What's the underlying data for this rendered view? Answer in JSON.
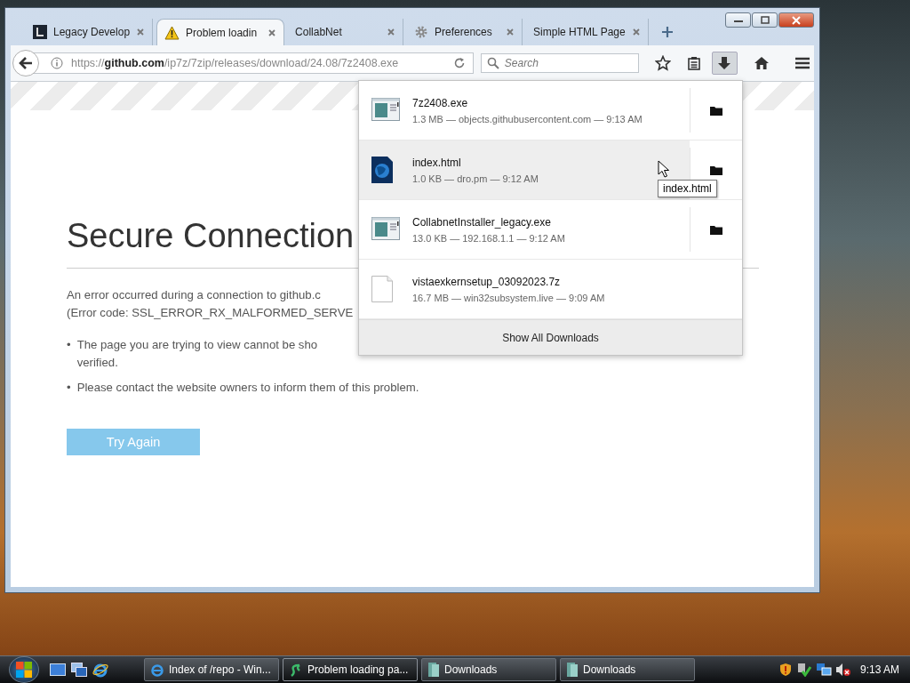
{
  "window": {
    "tabs": [
      {
        "label": "Legacy Develop",
        "selected": false
      },
      {
        "label": "Problem loadin",
        "selected": true
      },
      {
        "label": "CollabNet",
        "selected": false
      },
      {
        "label": "Preferences",
        "selected": false
      },
      {
        "label": "Simple HTML Page",
        "selected": false
      }
    ],
    "address_bar": {
      "url": "https://**github.com**/ip7z/7zip/releases/download/24.08/7z2408.exe"
    },
    "search": {
      "placeholder": "Search"
    },
    "downloads_button": {
      "pressed": true
    },
    "page": {
      "title": "Secure Connection",
      "message_lines": [
        "An error occurred during a connection to github.c",
        "(Error code: SSL_ERROR_RX_MALFORMED_SERVE"
      ],
      "bullets": [
        {
          "marker": "•",
          "lines": [
            "The page you are trying to view cannot be sho",
            "verified."
          ]
        },
        {
          "marker": "•",
          "lines": [
            "Please contact the website owners to inform them of this problem."
          ]
        }
      ],
      "button": "Try Again"
    },
    "downloads_panel": {
      "items": [
        {
          "kind": "exe",
          "name": "7z2408.exe",
          "details": "1.3 MB — objects.githubusercontent.com — 9:13 AM",
          "hovered": false,
          "folder_button": true
        },
        {
          "kind": "html",
          "name": "index.html",
          "details": "1.0 KB — dro.pm — 9:12 AM",
          "hovered": true,
          "folder_button": true
        },
        {
          "kind": "exe",
          "name": "CollabnetInstaller_legacy.exe",
          "details": "13.0 KB — 192.168.1.1 — 9:12 AM",
          "hovered": false,
          "folder_button": true
        },
        {
          "kind": "file",
          "name": "vistaexkernsetup_03092023.7z",
          "details": "16.7 MB — win32subsystem.live — 9:09 AM",
          "hovered": false,
          "folder_button": false
        }
      ],
      "footer": "Show All Downloads"
    },
    "tooltip": "index.html"
  },
  "taskbar": {
    "buttons": [
      {
        "label": "Index of /repo - Win...",
        "selected": false
      },
      {
        "label": "Problem loading pa...",
        "selected": true
      },
      {
        "label": "Downloads",
        "selected": false
      },
      {
        "label": "Downloads",
        "selected": false
      }
    ],
    "clock": "9:13 AM"
  }
}
